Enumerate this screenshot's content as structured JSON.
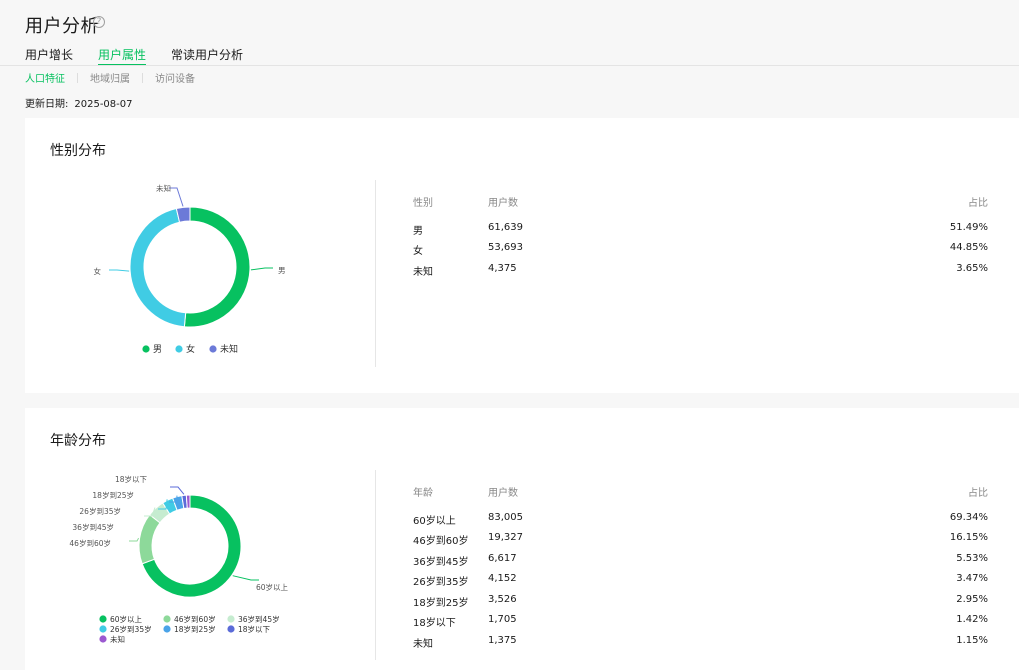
{
  "page": {
    "title": "用户分析",
    "help_icon": "?",
    "tabs": [
      {
        "label": "用户增长",
        "active": false
      },
      {
        "label": "用户属性",
        "active": true
      },
      {
        "label": "常读用户分析",
        "active": false
      }
    ],
    "subtabs": [
      {
        "label": "人口特征",
        "active": true
      },
      {
        "label": "地域归属",
        "active": false
      },
      {
        "label": "访问设备",
        "active": false
      }
    ],
    "update_label": "更新日期:",
    "update_value": "2025-08-07"
  },
  "colors": {
    "accent": "#07c160",
    "male": "#07c160",
    "female": "#40cce4",
    "unknown": "#6c7ad8",
    "age_60p": "#07c160",
    "age_46_60": "#8dd99a",
    "age_36_45": "#c6ecd0",
    "age_26_35": "#40cce4",
    "age_18_25": "#4aa3e8",
    "age_u18": "#5b6bd8",
    "age_unknown": "#9b59d0"
  },
  "gender": {
    "title": "性别分布",
    "table": {
      "headers": [
        "性别",
        "用户数",
        "占比"
      ],
      "rows": [
        {
          "label": "男",
          "count": "61,639",
          "pct": "51.49%"
        },
        {
          "label": "女",
          "count": "53,693",
          "pct": "44.85%"
        },
        {
          "label": "未知",
          "count": "4,375",
          "pct": "3.65%"
        }
      ]
    }
  },
  "age": {
    "title": "年龄分布",
    "table": {
      "headers": [
        "年龄",
        "用户数",
        "占比"
      ],
      "rows": [
        {
          "label": "60岁以上",
          "count": "83,005",
          "pct": "69.34%"
        },
        {
          "label": "46岁到60岁",
          "count": "19,327",
          "pct": "16.15%"
        },
        {
          "label": "36岁到45岁",
          "count": "6,617",
          "pct": "5.53%"
        },
        {
          "label": "26岁到35岁",
          "count": "4,152",
          "pct": "3.47%"
        },
        {
          "label": "18岁到25岁",
          "count": "3,526",
          "pct": "2.95%"
        },
        {
          "label": "18岁以下",
          "count": "1,705",
          "pct": "1.42%"
        },
        {
          "label": "未知",
          "count": "1,375",
          "pct": "1.15%"
        }
      ]
    }
  },
  "chart_data": [
    {
      "type": "pie",
      "title": "",
      "categories": [
        "男",
        "女",
        "未知"
      ],
      "values": [
        51.49,
        44.85,
        3.65
      ],
      "colors": [
        "#07c160",
        "#40cce4",
        "#6c7ad8"
      ],
      "legend": "bottom",
      "donut": true
    },
    {
      "type": "pie",
      "title": "",
      "categories": [
        "60岁以上",
        "46岁到60岁",
        "36岁到45岁",
        "26岁到35岁",
        "18岁到25岁",
        "18岁以下",
        "未知"
      ],
      "values": [
        69.34,
        16.15,
        5.53,
        3.47,
        2.95,
        1.42,
        1.15
      ],
      "colors": [
        "#07c160",
        "#8dd99a",
        "#c6ecd0",
        "#40cce4",
        "#4aa3e8",
        "#5b6bd8",
        "#9b59d0"
      ],
      "legend": "bottom",
      "donut": true
    }
  ]
}
